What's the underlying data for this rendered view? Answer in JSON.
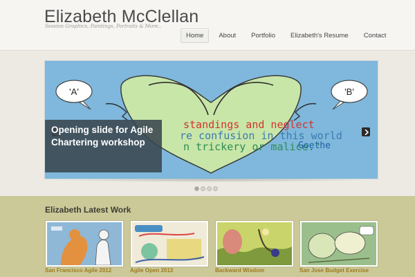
{
  "site": {
    "title": "Elizabeth McClellan",
    "tagline": "Session Graphics, Paintings, Portraits & More.."
  },
  "nav": {
    "items": [
      {
        "label": "Home",
        "active": true
      },
      {
        "label": "About",
        "active": false
      },
      {
        "label": "Portfolio",
        "active": false
      },
      {
        "label": "Elizabeth's Resume",
        "active": false
      },
      {
        "label": "Contact",
        "active": false
      }
    ]
  },
  "slider": {
    "caption": "Opening slide for Agile Chartering workshop",
    "bubble_left": "'A'",
    "bubble_right": "'B'",
    "quote_line1": "standings and neglect",
    "quote_line2": "re confusion in this world",
    "quote_line3": "n trickery or malice.\"",
    "quote_author": "Goethe",
    "prev_icon": "chevron-left-icon",
    "next_icon": "chevron-right-icon",
    "slide_count": 4,
    "active_slide": 1
  },
  "latest": {
    "title": "Elizabeth Latest Work",
    "items": [
      {
        "caption": "San Francisco Agile 2012"
      },
      {
        "caption": "Agile Open 2013"
      },
      {
        "caption": "Backward Wisdom"
      },
      {
        "caption": "San Jose Budget Exercise"
      }
    ]
  },
  "colors": {
    "header_bg": "#f6f5f2",
    "slide_bg": "#7fb8dc",
    "heart_fill": "#c8e6a8",
    "latest_bg": "#ccc999",
    "caption_link": "#9c7a1e"
  }
}
